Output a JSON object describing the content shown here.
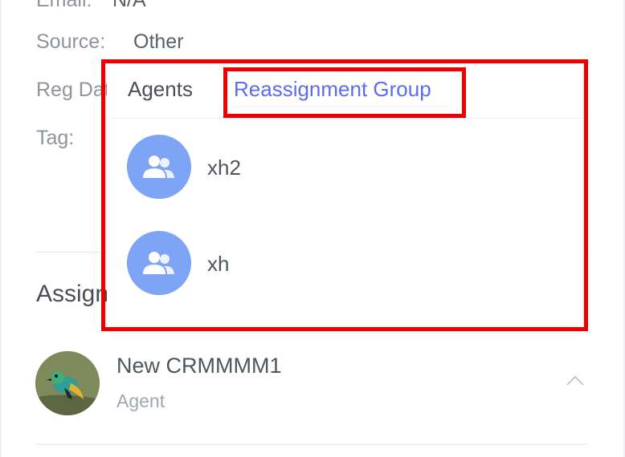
{
  "contact_info": {
    "email": {
      "label": "Email:",
      "value": "N/A"
    },
    "source": {
      "label": "Source:",
      "value": "Other"
    },
    "reg_date": {
      "label": "Reg Date:"
    },
    "tag": {
      "label": "Tag:"
    }
  },
  "assignment": {
    "title": "Assignee",
    "agent": {
      "name": "New CRMMMM1",
      "role": "Agent"
    }
  },
  "reassign_popover": {
    "tabs": [
      {
        "label": "Agents",
        "active": false
      },
      {
        "label": "Reassignment Group",
        "active": true
      }
    ],
    "groups": [
      {
        "name": "xh2"
      },
      {
        "name": "xh"
      }
    ]
  },
  "colors": {
    "accent": "#5d6bf0",
    "group_avatar": "#7ea4f6",
    "highlight": "#ee0000"
  }
}
